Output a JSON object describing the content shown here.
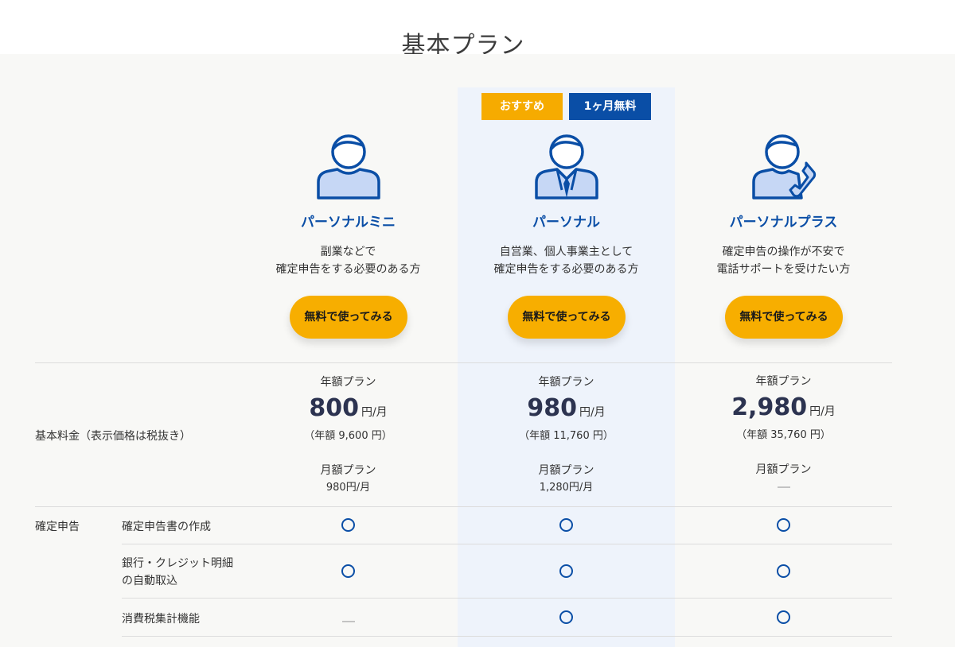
{
  "title": "基本プラン",
  "badges": {
    "recommended": "おすすめ",
    "free_month": "1ヶ月無料"
  },
  "plans": [
    {
      "name": "パーソナルミニ",
      "desc_line1": "副業などで",
      "desc_line2": "確定申告をする必要のある方",
      "cta": "無料で使ってみる",
      "annual_label": "年額プラン",
      "price": "800",
      "price_unit": "円/月",
      "annual_total": "（年額 9,600 円）",
      "monthly_label": "月額プラン",
      "monthly_price": "980円/月"
    },
    {
      "name": "パーソナル",
      "desc_line1": "自営業、個人事業主として",
      "desc_line2": "確定申告をする必要のある方",
      "cta": "無料で使ってみる",
      "annual_label": "年額プラン",
      "price": "980",
      "price_unit": "円/月",
      "annual_total": "（年額 11,760 円）",
      "monthly_label": "月額プラン",
      "monthly_price": "1,280円/月"
    },
    {
      "name": "パーソナルプラス",
      "desc_line1": "確定申告の操作が不安で",
      "desc_line2": "電話サポートを受けたい方",
      "cta": "無料で使ってみる",
      "annual_label": "年額プラン",
      "price": "2,980",
      "price_unit": "円/月",
      "annual_total": "（年額 35,760 円）",
      "monthly_label": "月額プラン",
      "monthly_price": null
    }
  ],
  "basic_fee_label": "基本料金（表示価格は税抜き）",
  "section_label": "確定申告",
  "features": [
    {
      "name_line1": "確定申告書の作成",
      "name_line2": "",
      "availability": [
        "included",
        "included",
        "included"
      ]
    },
    {
      "name_line1": "銀行・クレジット明細",
      "name_line2": "の自動取込",
      "availability": [
        "included",
        "included",
        "included"
      ]
    },
    {
      "name_line1": "消費税集計機能",
      "name_line2": "",
      "availability": [
        "not-included",
        "included",
        "included"
      ]
    }
  ],
  "colors": {
    "accent_blue": "#0a4ea6",
    "cta_yellow": "#f7ae00",
    "highlight_bg": "#eef3fb"
  }
}
